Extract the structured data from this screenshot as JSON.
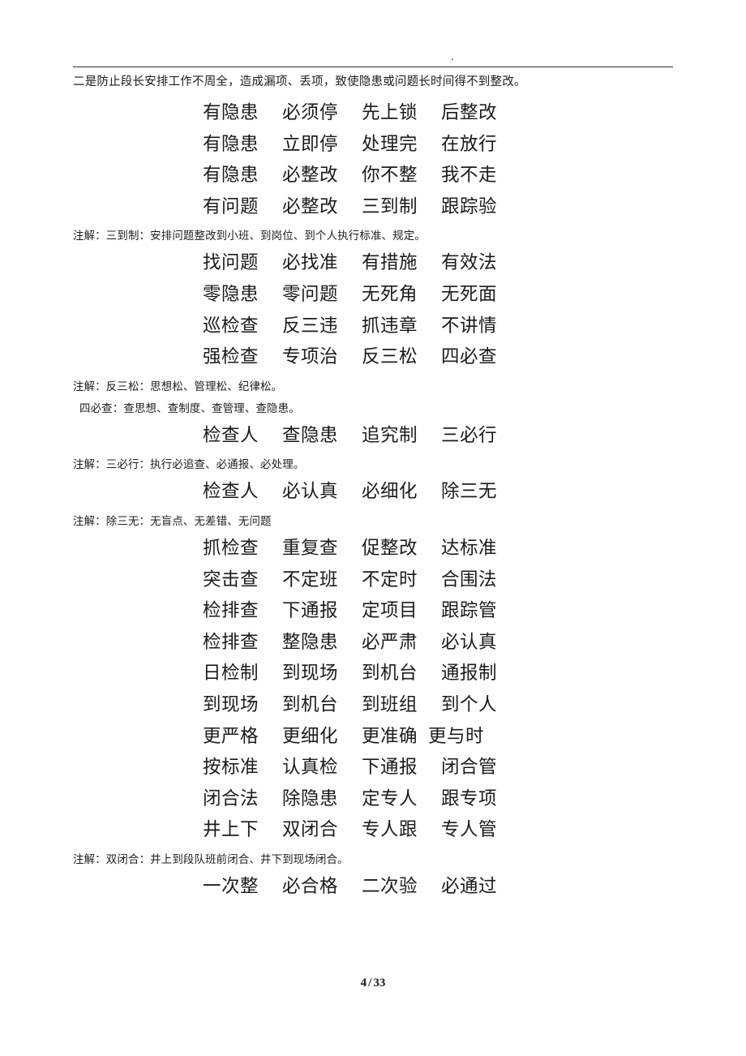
{
  "header": {
    "mark": "."
  },
  "body": {
    "intro_paragraph": "二是防止段长安排工作不周全，造成漏项、丢项，致使隐患或问题长时间得不到整改。",
    "notes": {
      "san_dao_zhi": "注解：三到制：安排问题整改到小班、到岗位、到个人执行标准、规定。",
      "fan_san_song": "注解：反三松：思想松、管理松、纪律松。",
      "si_bi_cha": "四必查：查思想、查制度、查管理、查隐患。",
      "san_bi_xing": "注解：三必行：执行必追查、必通报、必处理。",
      "chu_san_wu": "注解：除三无：无盲点、无差错、无问题",
      "shuang_bi_he": "注解：双闭合：井上到段队班前闭合、井下到现场闭合。"
    },
    "verse_groups": [
      {
        "id": "group-1",
        "rows": [
          [
            "有隐患",
            "必须停",
            "先上锁",
            "后整改"
          ],
          [
            "有隐患",
            "立即停",
            "处理完",
            "在放行"
          ],
          [
            "有隐患",
            "必整改",
            "你不整",
            "我不走"
          ],
          [
            "有问题",
            "必整改",
            "三到制",
            "跟踪验"
          ]
        ]
      },
      {
        "id": "group-2",
        "rows": [
          [
            "找问题",
            "必找准",
            "有措施",
            "有效法"
          ],
          [
            "零隐患",
            "零问题",
            "无死角",
            "无死面"
          ],
          [
            "巡检查",
            "反三违",
            "抓违章",
            "不讲情"
          ],
          [
            "强检查",
            "专项治",
            "反三松",
            "四必查"
          ]
        ]
      },
      {
        "id": "group-3",
        "rows": [
          [
            "检查人",
            "查隐患",
            "追究制",
            "三必行"
          ]
        ]
      },
      {
        "id": "group-4",
        "rows": [
          [
            "检查人",
            "必认真",
            "必细化",
            "除三无"
          ]
        ]
      },
      {
        "id": "group-5",
        "rows": [
          [
            "抓检查",
            "重复查",
            "促整改",
            "达标准"
          ],
          [
            "突击查",
            "不定班",
            "不定时",
            "合围法"
          ],
          [
            "检排查",
            "下通报",
            "定项目",
            "跟踪管"
          ],
          [
            "检排查",
            "整隐患",
            "必严肃",
            "必认真"
          ],
          [
            "日检制",
            "到现场",
            "到机台",
            "通报制"
          ],
          [
            "到现场",
            "到机台",
            "到班组",
            "到个人"
          ],
          [
            "更严格",
            "更细化",
            "更准确",
            "更与时"
          ],
          [
            "按标准",
            "认真检",
            "下通报",
            "闭合管"
          ],
          [
            "闭合法",
            "除隐患",
            "定专人",
            "跟专项"
          ],
          [
            "井上下",
            "双闭合",
            "专人跟",
            "专人管"
          ]
        ]
      },
      {
        "id": "group-6",
        "rows": [
          [
            "一次整",
            "必合格",
            "二次验",
            "必通过"
          ]
        ]
      }
    ]
  },
  "footer": {
    "page_number": "4",
    "separator": "/",
    "total_pages": "33"
  }
}
